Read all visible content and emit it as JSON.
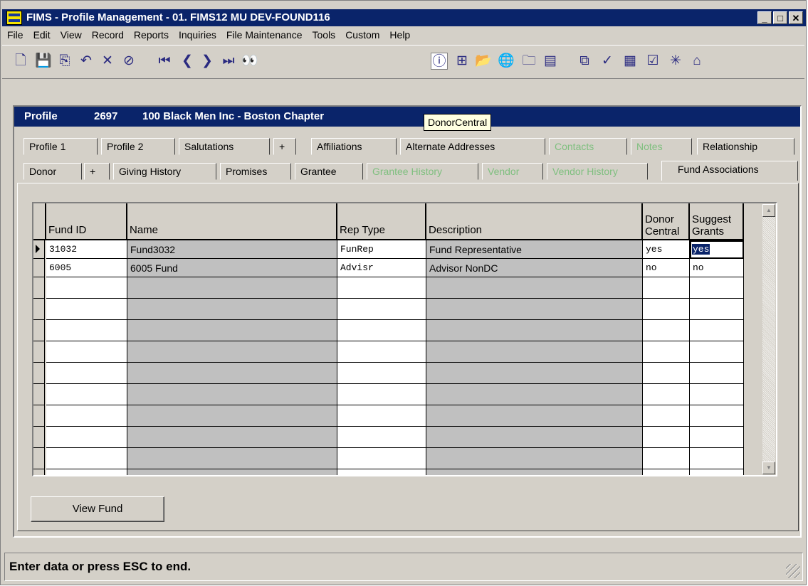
{
  "window": {
    "title": "FIMS - Profile Management - 01. FIMS12 MU DEV-FOUND116"
  },
  "menu": [
    "File",
    "Edit",
    "View",
    "Record",
    "Reports",
    "Inquiries",
    "File Maintenance",
    "Tools",
    "Custom",
    "Help"
  ],
  "toolbar": {
    "icons": [
      "new-icon",
      "save-icon",
      "copy-icon",
      "undo-icon",
      "delete-icon",
      "cancel-icon",
      "first-record-icon",
      "previous-record-icon",
      "next-record-icon",
      "last-record-icon",
      "binoculars-icon",
      "info-icon",
      "org-chart-icon",
      "open-folder-icon",
      "internet-icon",
      "folder-search-icon",
      "card-icon",
      "diagram-icon",
      "spellcheck-icon",
      "calculator-icon",
      "checklist-icon",
      "network-icon",
      "home-icon"
    ],
    "glyphs": [
      "🗋",
      "💾",
      "⎘",
      "↶",
      "✕",
      "⊘",
      "⏮",
      "❮",
      "❯",
      "⏭",
      "👀",
      "ⓘ",
      "⊞",
      "📂",
      "🌐",
      "🗀",
      "▤",
      "⧉",
      "✓",
      "▦",
      "☑",
      "✳",
      "⌂"
    ]
  },
  "profile": {
    "label": "Profile",
    "number": "2697",
    "name": "100 Black Men Inc - Boston Chapter"
  },
  "tooltip": "DonorCentral",
  "tabs_row1": [
    {
      "label": "Profile 1",
      "enabled": true
    },
    {
      "label": "Profile 2",
      "enabled": true
    },
    {
      "label": "Salutations",
      "enabled": true
    },
    {
      "label": "+",
      "enabled": true
    },
    {
      "label": "Affiliations",
      "enabled": true
    },
    {
      "label": "Alternate Addresses",
      "enabled": true
    },
    {
      "label": "Contacts",
      "enabled": false
    },
    {
      "label": "Notes",
      "enabled": false
    },
    {
      "label": "Relationship",
      "enabled": true
    }
  ],
  "tabs_row2": [
    {
      "label": "Donor",
      "enabled": true
    },
    {
      "label": "+",
      "enabled": true
    },
    {
      "label": "Giving History",
      "enabled": true
    },
    {
      "label": "Promises",
      "enabled": true
    },
    {
      "label": "Grantee",
      "enabled": true
    },
    {
      "label": "Grantee History",
      "enabled": false
    },
    {
      "label": "Vendor",
      "enabled": false
    },
    {
      "label": "Vendor History",
      "enabled": false
    },
    {
      "label": "Fund Associations",
      "enabled": true,
      "selected": true
    }
  ],
  "grid": {
    "columns": [
      "Fund ID",
      "Name",
      "Rep Type",
      "Description",
      "Donor\nCentral",
      "Suggest\nGrants"
    ],
    "rows": [
      {
        "fund_id": "31032",
        "name": "Fund3032",
        "rep_type": "FunRep",
        "description": "Fund Representative",
        "donor_central": "yes",
        "suggest_grants": "yes"
      },
      {
        "fund_id": "6005",
        "name": "6005 Fund",
        "rep_type": "Advisr",
        "description": "Advisor NonDC",
        "donor_central": "no",
        "suggest_grants": "no"
      }
    ]
  },
  "buttons": {
    "view_fund": "View Fund"
  },
  "status": "Enter data or press ESC to end."
}
